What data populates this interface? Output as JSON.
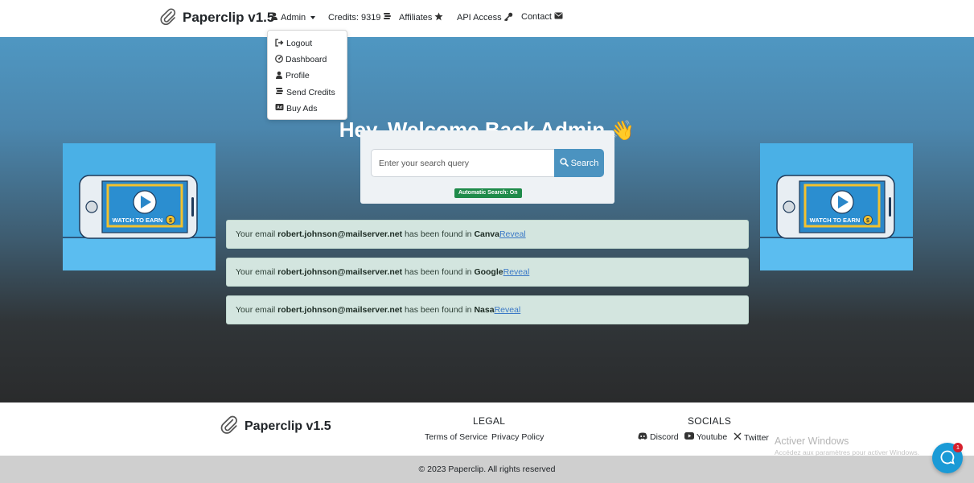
{
  "navbar": {
    "brand": "Paperclip v1.5",
    "user_menu": "Admin",
    "credits": "Credits: 9319",
    "affiliates": "Affiliates",
    "api_access": "API Access",
    "contact": "Contact"
  },
  "dropdown": {
    "items": [
      {
        "label": "Logout",
        "icon": "logout-icon"
      },
      {
        "label": "Dashboard",
        "icon": "dashboard-icon"
      },
      {
        "label": "Profile",
        "icon": "user-icon"
      },
      {
        "label": "Send Credits",
        "icon": "coins-icon"
      },
      {
        "label": "Buy Ads",
        "icon": "ad-icon"
      }
    ]
  },
  "hero": {
    "welcome": "Hey, Welcome Back Admin",
    "wave_emoji": "👋"
  },
  "ads": {
    "text": "WATCH TO EARN"
  },
  "search": {
    "placeholder": "Enter your search query",
    "button_label": "Search",
    "auto_badge": "Automatic Search: On"
  },
  "results": [
    {
      "prefix": "Your email ",
      "email": "robert.johnson@mailserver.net",
      "middle": " has been found in ",
      "source": "Canva",
      "action": "Reveal"
    },
    {
      "prefix": "Your email ",
      "email": "robert.johnson@mailserver.net",
      "middle": " has been found in ",
      "source": "Google",
      "action": "Reveal"
    },
    {
      "prefix": "Your email ",
      "email": "robert.johnson@mailserver.net",
      "middle": " has been found in ",
      "source": "Nasa",
      "action": "Reveal"
    }
  ],
  "footer": {
    "brand": "Paperclip v1.5",
    "legal_heading": "LEGAL",
    "terms": "Terms of Service",
    "privacy": "Privacy Policy",
    "socials_heading": "SOCIALS",
    "discord": "Discord",
    "youtube": "Youtube",
    "twitter": "Twitter",
    "copyright": "© 2023 Paperclip. All rights reserved"
  },
  "windows_watermark": {
    "title": "Activer Windows",
    "subtitle": "Accédez aux paramètres pour activer Windows."
  },
  "chat": {
    "badge_count": "1"
  },
  "colors": {
    "accent": "#4b93c0",
    "badge_green": "#1f8b4a",
    "alert_bg": "#d3e5df",
    "link": "#3a78c6",
    "chat": "#1a9ad6"
  }
}
